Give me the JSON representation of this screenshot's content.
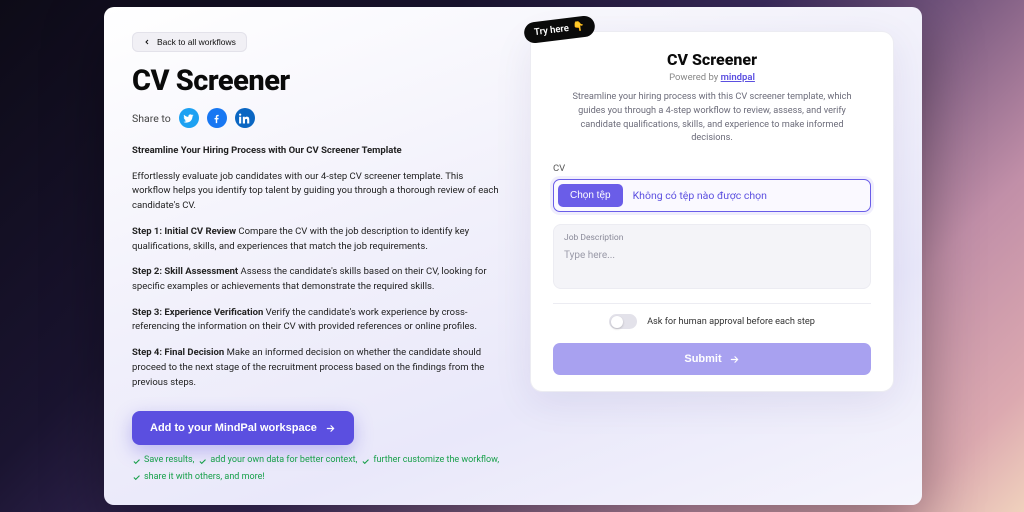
{
  "nav": {
    "back_label": "Back to all workflows"
  },
  "page": {
    "title": "CV Screener",
    "share_label": "Share to"
  },
  "article": {
    "tagline": "Streamline Your Hiring Process with Our CV Screener Template",
    "intro": "Effortlessly evaluate job candidates with our 4-step CV screener template. This workflow helps you identify top talent by guiding you through a thorough review of each candidate's CV.",
    "steps": [
      {
        "title": "Step 1: Initial CV Review",
        "text": " Compare the CV with the job description to identify key qualifications, skills, and experiences that match the job requirements."
      },
      {
        "title": "Step 2: Skill Assessment",
        "text": " Assess the candidate's skills based on their CV, looking for specific examples or achievements that demonstrate the required skills."
      },
      {
        "title": "Step 3: Experience Verification",
        "text": " Verify the candidate's work experience by cross-referencing the information on their CV with provided references or online profiles."
      },
      {
        "title": "Step 4: Final Decision",
        "text": " Make an informed decision on whether the candidate should proceed to the next stage of the recruitment process based on the findings from the previous steps."
      }
    ]
  },
  "cta": {
    "label": "Add to your MindPal workspace"
  },
  "benefits": [
    "Save results,",
    "add your own data for better context,",
    "further customize the workflow,",
    "share it with others, and more!"
  ],
  "widget": {
    "try_label": "Try here",
    "try_emoji": "👇",
    "title": "CV Screener",
    "powered_prefix": "Powered by ",
    "powered_brand": "mindpal",
    "description": "Streamline your hiring process with this CV screener template, which guides you through a 4-step workflow to review, assess, and verify candidate qualifications, skills, and experience to make informed decisions.",
    "cv_label": "CV",
    "file_button": "Chọn tệp",
    "file_status": "Không có tệp nào được chọn",
    "jd_label": "Job Description",
    "jd_placeholder": "Type here...",
    "toggle_label": "Ask for human approval before each step",
    "submit_label": "Submit"
  }
}
